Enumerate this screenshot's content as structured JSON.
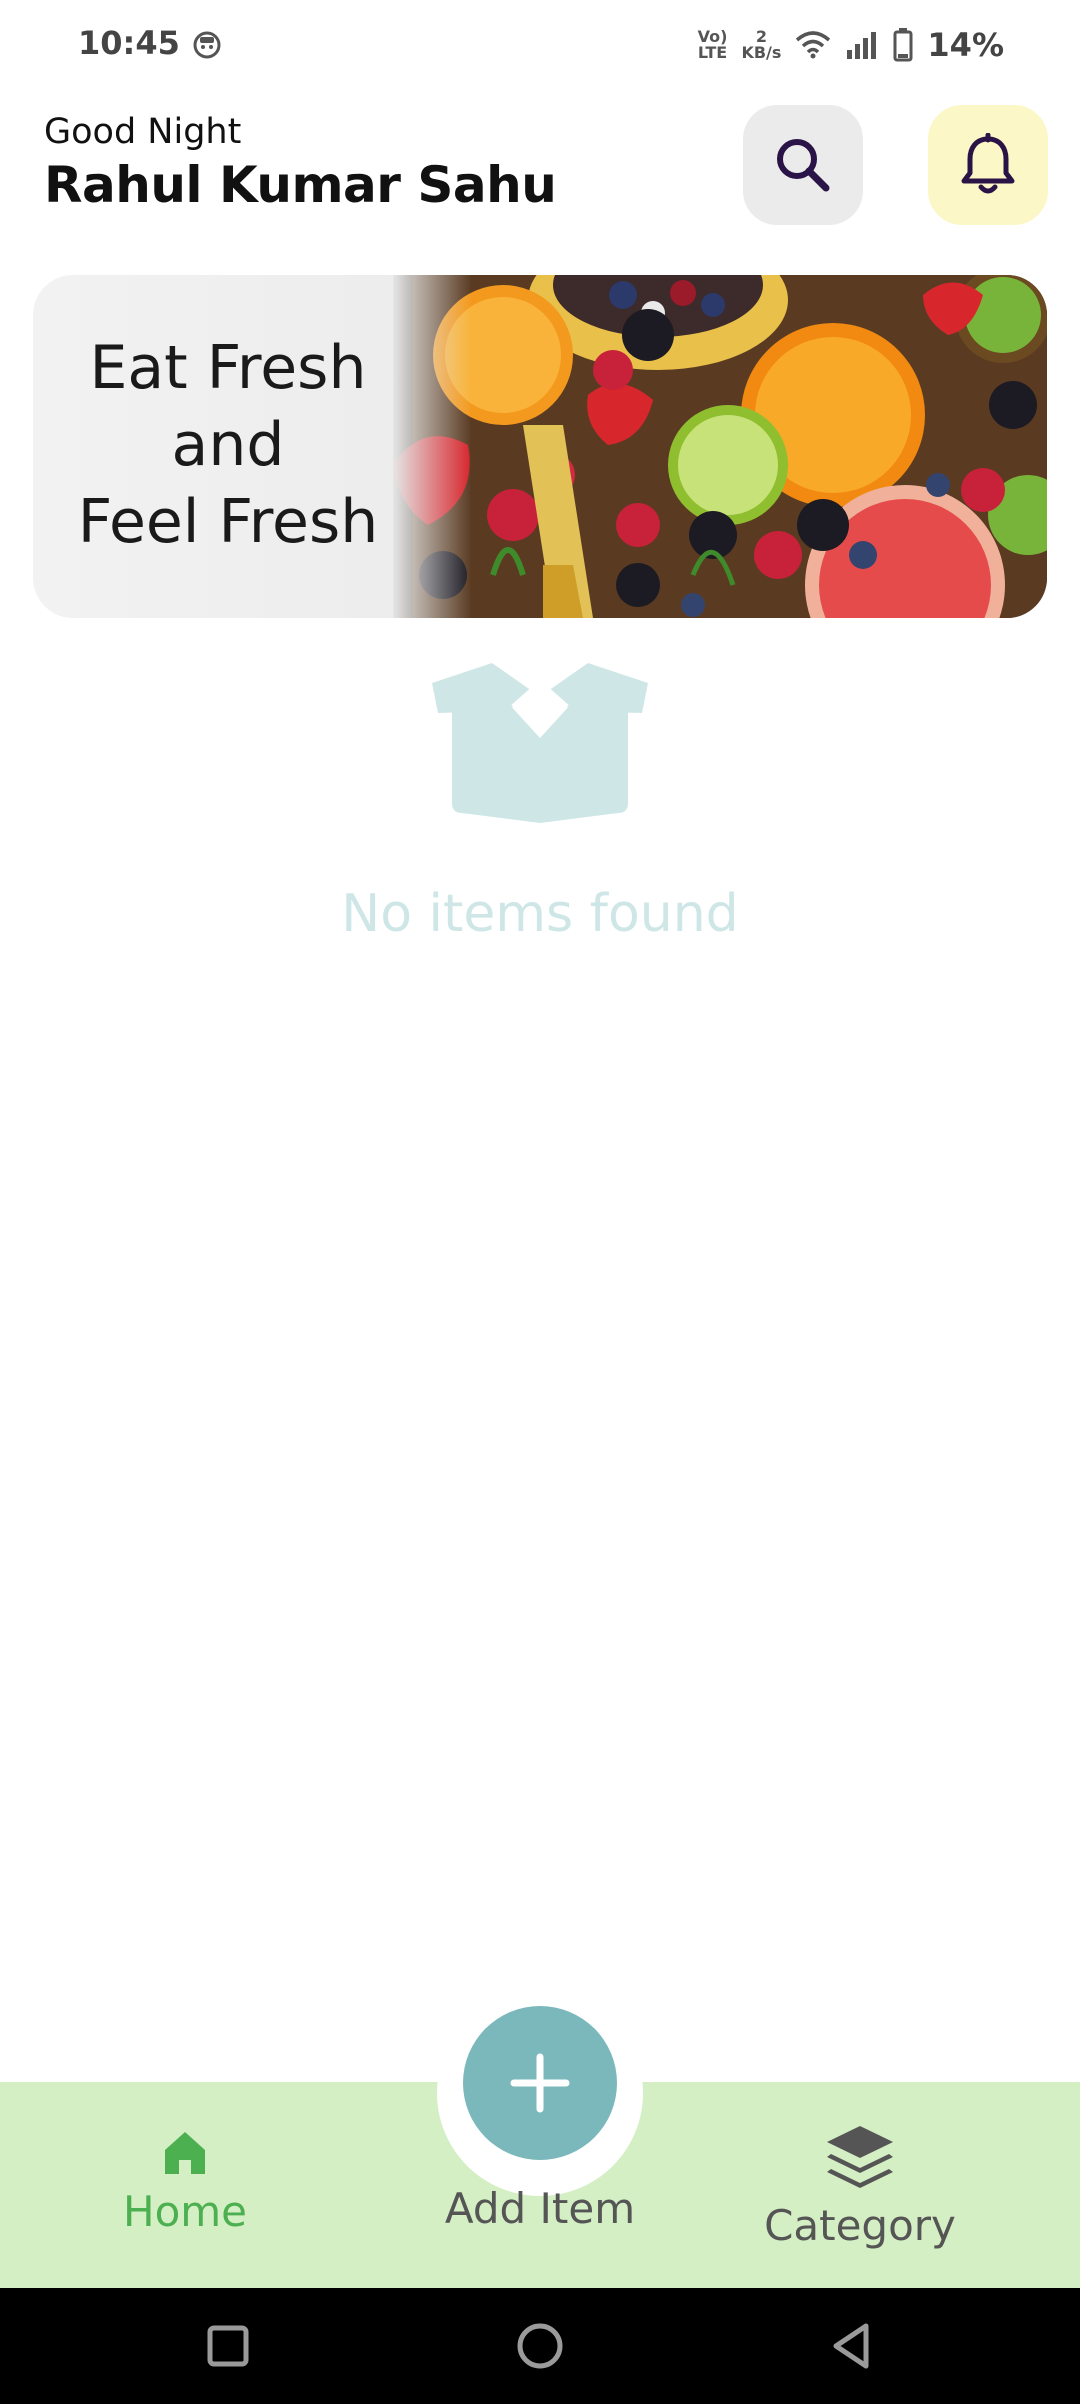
{
  "status_bar": {
    "time": "10:45",
    "volte_line1": "Vo)",
    "volte_line2": "LTE",
    "speed_value": "2",
    "speed_unit": "KB/s",
    "battery": "14%"
  },
  "header": {
    "greeting": "Good Night",
    "user_name": "Rahul Kumar Sahu"
  },
  "banner": {
    "line1": "Eat Fresh",
    "line2": "and",
    "line3": "Feel Fresh"
  },
  "empty_state": {
    "message": "No items found"
  },
  "bottom_nav": {
    "home_label": "Home",
    "add_label": "Add Item",
    "category_label": "Category",
    "active": "Home"
  },
  "colors": {
    "accent_green": "#4caf50",
    "nav_background": "#d5efc5",
    "fab": "#7ab8bc",
    "bell_background": "#fbf7c6",
    "search_background": "#ebebeb",
    "empty_state": "#cfe6e7",
    "icon_dark": "#2a1346"
  }
}
